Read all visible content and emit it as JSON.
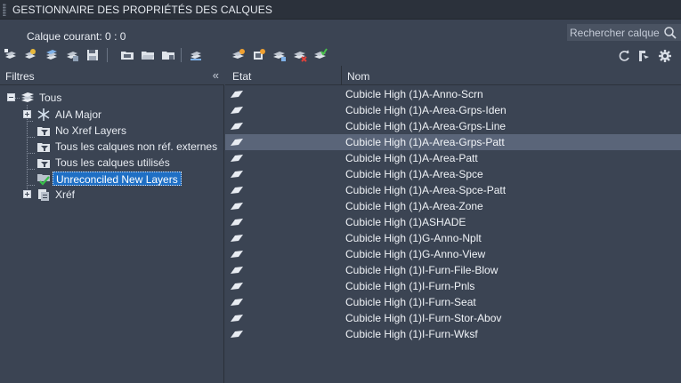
{
  "window": {
    "title": "GESTIONNAIRE DES PROPRIÉTÉS DES CALQUES"
  },
  "current_layer": "Calque courant: 0 : 0",
  "search": {
    "placeholder": "Rechercher calque"
  },
  "filters": {
    "header": "Filtres",
    "collapse_glyph": "«",
    "tree": [
      {
        "label": "Tous",
        "icon": "layer-stack-icon"
      },
      {
        "label": "AIA Major",
        "icon": "filter-snowflake-icon"
      },
      {
        "label": "No Xref Layers",
        "icon": "filter-folder-icon"
      },
      {
        "label": "Tous les calques non réf. externes",
        "icon": "filter-folder-icon"
      },
      {
        "label": "Tous les calques utilisés",
        "icon": "filter-folder-icon"
      },
      {
        "label": "Unreconciled New Layers",
        "icon": "filter-check-icon",
        "selected": true
      },
      {
        "label": "Xréf",
        "icon": "xref-icon"
      }
    ]
  },
  "columns": {
    "state": "Etat",
    "name": "Nom"
  },
  "layers": [
    {
      "name": "Cubicle High (1)A-Anno-Scrn"
    },
    {
      "name": "Cubicle High (1)A-Area-Grps-Iden"
    },
    {
      "name": "Cubicle High (1)A-Area-Grps-Line"
    },
    {
      "name": "Cubicle High (1)A-Area-Grps-Patt",
      "selected": true
    },
    {
      "name": "Cubicle High (1)A-Area-Patt"
    },
    {
      "name": "Cubicle High (1)A-Area-Spce"
    },
    {
      "name": "Cubicle High (1)A-Area-Spce-Patt"
    },
    {
      "name": "Cubicle High (1)A-Area-Zone"
    },
    {
      "name": "Cubicle High (1)ASHADE"
    },
    {
      "name": "Cubicle High (1)G-Anno-Nplt"
    },
    {
      "name": "Cubicle High (1)G-Anno-View"
    },
    {
      "name": "Cubicle High (1)I-Furn-File-Blow"
    },
    {
      "name": "Cubicle High (1)I-Furn-Pnls"
    },
    {
      "name": "Cubicle High (1)I-Furn-Seat"
    },
    {
      "name": "Cubicle High (1)I-Furn-Stor-Abov"
    },
    {
      "name": "Cubicle High (1)I-Furn-Wksf"
    }
  ],
  "colors": {
    "background": "#3b4453",
    "titlebar": "#2b313b",
    "selection_blue": "#1f6fc4",
    "row_selected": "#5a6579"
  }
}
